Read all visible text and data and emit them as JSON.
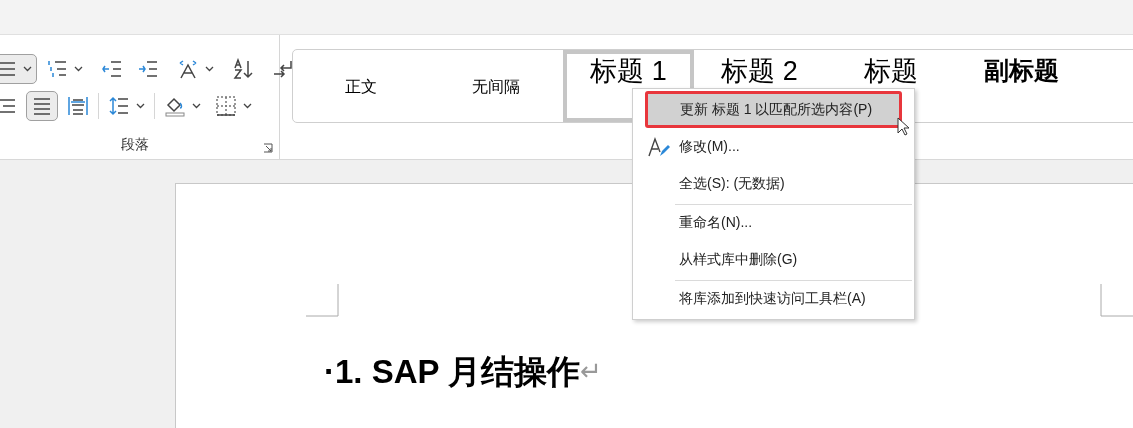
{
  "paragraph_group": {
    "label": "段落",
    "rows": [
      [
        {
          "kind": "bullets",
          "selected": true,
          "dropdown": true
        },
        {
          "kind": "numbering",
          "selected": false,
          "dropdown": true
        },
        {
          "kind": "outdent",
          "selected": false,
          "dropdown": false
        },
        {
          "kind": "indent",
          "selected": false,
          "dropdown": false
        },
        {
          "kind": "text-direction",
          "selected": false,
          "dropdown": true
        },
        {
          "kind": "sort",
          "selected": false,
          "dropdown": false
        },
        {
          "kind": "marks",
          "selected": false,
          "dropdown": false
        }
      ],
      [
        {
          "kind": "align-right",
          "selected": false,
          "dropdown": false
        },
        {
          "kind": "justify",
          "selected": true,
          "dropdown": false
        },
        {
          "kind": "distribute",
          "selected": false,
          "dropdown": false
        },
        {
          "kind": "line-spacing",
          "selected": false,
          "dropdown": true
        },
        {
          "kind": "shading",
          "selected": false,
          "dropdown": true
        },
        {
          "kind": "borders",
          "selected": false,
          "dropdown": true
        }
      ]
    ]
  },
  "styles_gallery": [
    {
      "label": "正文",
      "kind": "normal",
      "selected": false
    },
    {
      "label": "无间隔",
      "kind": "normal",
      "selected": false
    },
    {
      "label": "标题 1",
      "kind": "heading",
      "selected": true
    },
    {
      "label": "标题 2",
      "kind": "heading",
      "selected": false
    },
    {
      "label": "标题",
      "kind": "heading",
      "selected": false
    },
    {
      "label": "副标题",
      "kind": "subtitle",
      "selected": false
    }
  ],
  "context_menu": [
    {
      "label": "更新 标题 1 以匹配所选内容(P)",
      "selected": true,
      "icon": false,
      "separator_before": false
    },
    {
      "label": "修改(M)...",
      "selected": false,
      "icon": true,
      "separator_before": false
    },
    {
      "label": "全选(S): (无数据)",
      "selected": false,
      "icon": false,
      "separator_before": false
    },
    {
      "label": "重命名(N)...",
      "selected": false,
      "icon": false,
      "separator_before": true
    },
    {
      "label": "从样式库中删除(G)",
      "selected": false,
      "icon": false,
      "separator_before": false
    },
    {
      "label": "将库添加到快速访问工具栏(A)",
      "selected": false,
      "icon": false,
      "separator_before": true
    }
  ],
  "document": {
    "heading": "·1. SAP 月结操作",
    "paragraph_mark": "↵"
  }
}
